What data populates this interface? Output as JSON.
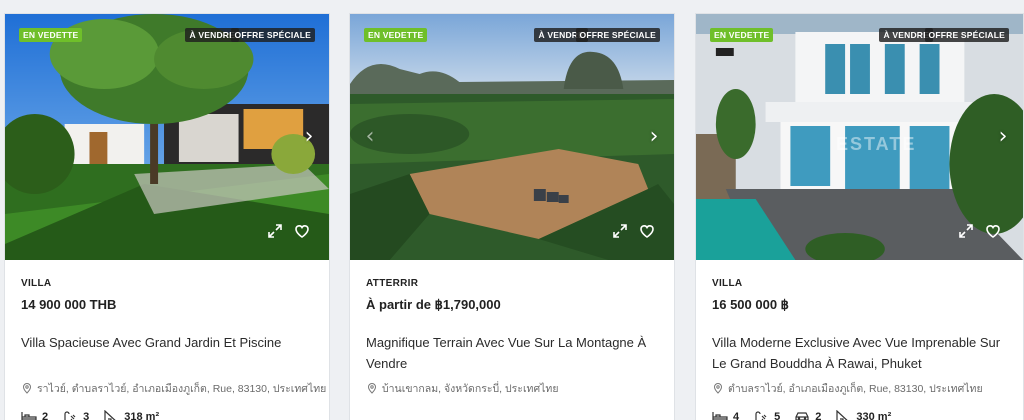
{
  "listings": [
    {
      "badges": {
        "featured": "EN VEDETTE",
        "sale": "À VENDRE",
        "special": "OFFRE SPÉCIALE"
      },
      "type": "VILLA",
      "price": "14 900 000 THB",
      "title": "Villa Spacieuse Avec Grand Jardin Et Piscine",
      "address": "ราไวย์, ตำบลราไวย์, อำเภอเมืองภูเก็ต, Rue, 83130, ประเทศไทย",
      "features": {
        "bedrooms": "2",
        "bathrooms": "3",
        "area": "318 m²"
      }
    },
    {
      "badges": {
        "featured": "EN VEDETTE",
        "sale": "À VENDRE",
        "special": "OFFRE SPÉCIALE"
      },
      "type": "ATTERRIR",
      "price": "À partir de ฿1,790,000",
      "title": "Magnifique Terrain Avec Vue Sur La Montagne À Vendre",
      "address": "บ้านเขากลม, จังหวัดกระบี่, ประเทศไทย"
    },
    {
      "badges": {
        "featured": "EN VEDETTE",
        "sale": "À VENDRE",
        "special": "OFFRE SPÉCIALE"
      },
      "type": "VILLA",
      "price": "16 500 000 ฿",
      "title": "Villa Moderne Exclusive Avec Vue Imprenable Sur Le Grand Bouddha À Rawai, Phuket",
      "address": "ตำบลราไวย์, อำเภอเมืองภูเก็ต, Rue, 83130, ประเทศไทย",
      "features": {
        "bedrooms": "4",
        "bathrooms": "5",
        "garage": "2",
        "area": "330 m²"
      },
      "watermark": "ESTATE"
    }
  ],
  "colors": {
    "featured": "#6fbf2a",
    "badge_dark": "#1e1e1e"
  },
  "icons": [
    "chevron-right-icon",
    "chevron-left-icon",
    "expand-icon",
    "heart-icon",
    "map-pin-icon",
    "bed-icon",
    "bath-icon",
    "garage-icon",
    "area-icon"
  ]
}
